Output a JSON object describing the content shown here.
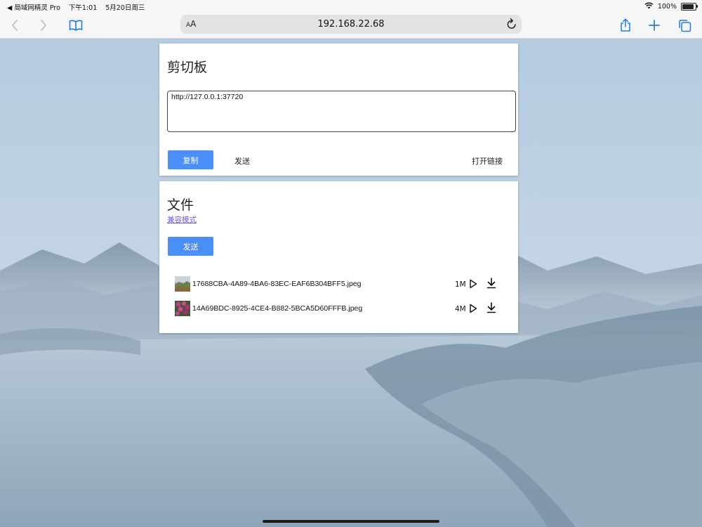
{
  "status_bar": {
    "back_app": "◀ 局域网精灵 Pro",
    "time": "下午1:01",
    "date": "5月20日周三",
    "battery_text": "100%",
    "battery_level": 1.0
  },
  "browser": {
    "url": "192.168.22.68",
    "aa_small": "A",
    "aa_large": "A"
  },
  "clipboard": {
    "title": "剪切板",
    "content": "http://127.0.0.1:37720",
    "copy_label": "复制",
    "send_label": "发送",
    "open_link_label": "打开链接"
  },
  "files": {
    "title": "文件",
    "compat_mode": "兼容模式",
    "send_label": "发送",
    "items": [
      {
        "name": "17688CBA-4A89-4BA6-83EC-EAF6B304BFF5.jpeg",
        "size": "1M"
      },
      {
        "name": "14A69BDC-8925-4CE4-B882-5BCA5D60FFFB.jpeg",
        "size": "4M"
      }
    ]
  },
  "colors": {
    "accent": "#4a8ff7",
    "link": "#6a5be0",
    "ios_blue": "#1f7aea"
  },
  "icons": {
    "back": "chevron-left-icon",
    "forward": "chevron-right-icon",
    "bookmarks": "book-icon",
    "reload": "reload-icon",
    "share": "share-icon",
    "new_tab": "plus-icon",
    "tabs": "tabs-icon",
    "wifi": "wifi-icon",
    "battery": "battery-icon",
    "play": "play-icon",
    "download": "download-icon"
  }
}
